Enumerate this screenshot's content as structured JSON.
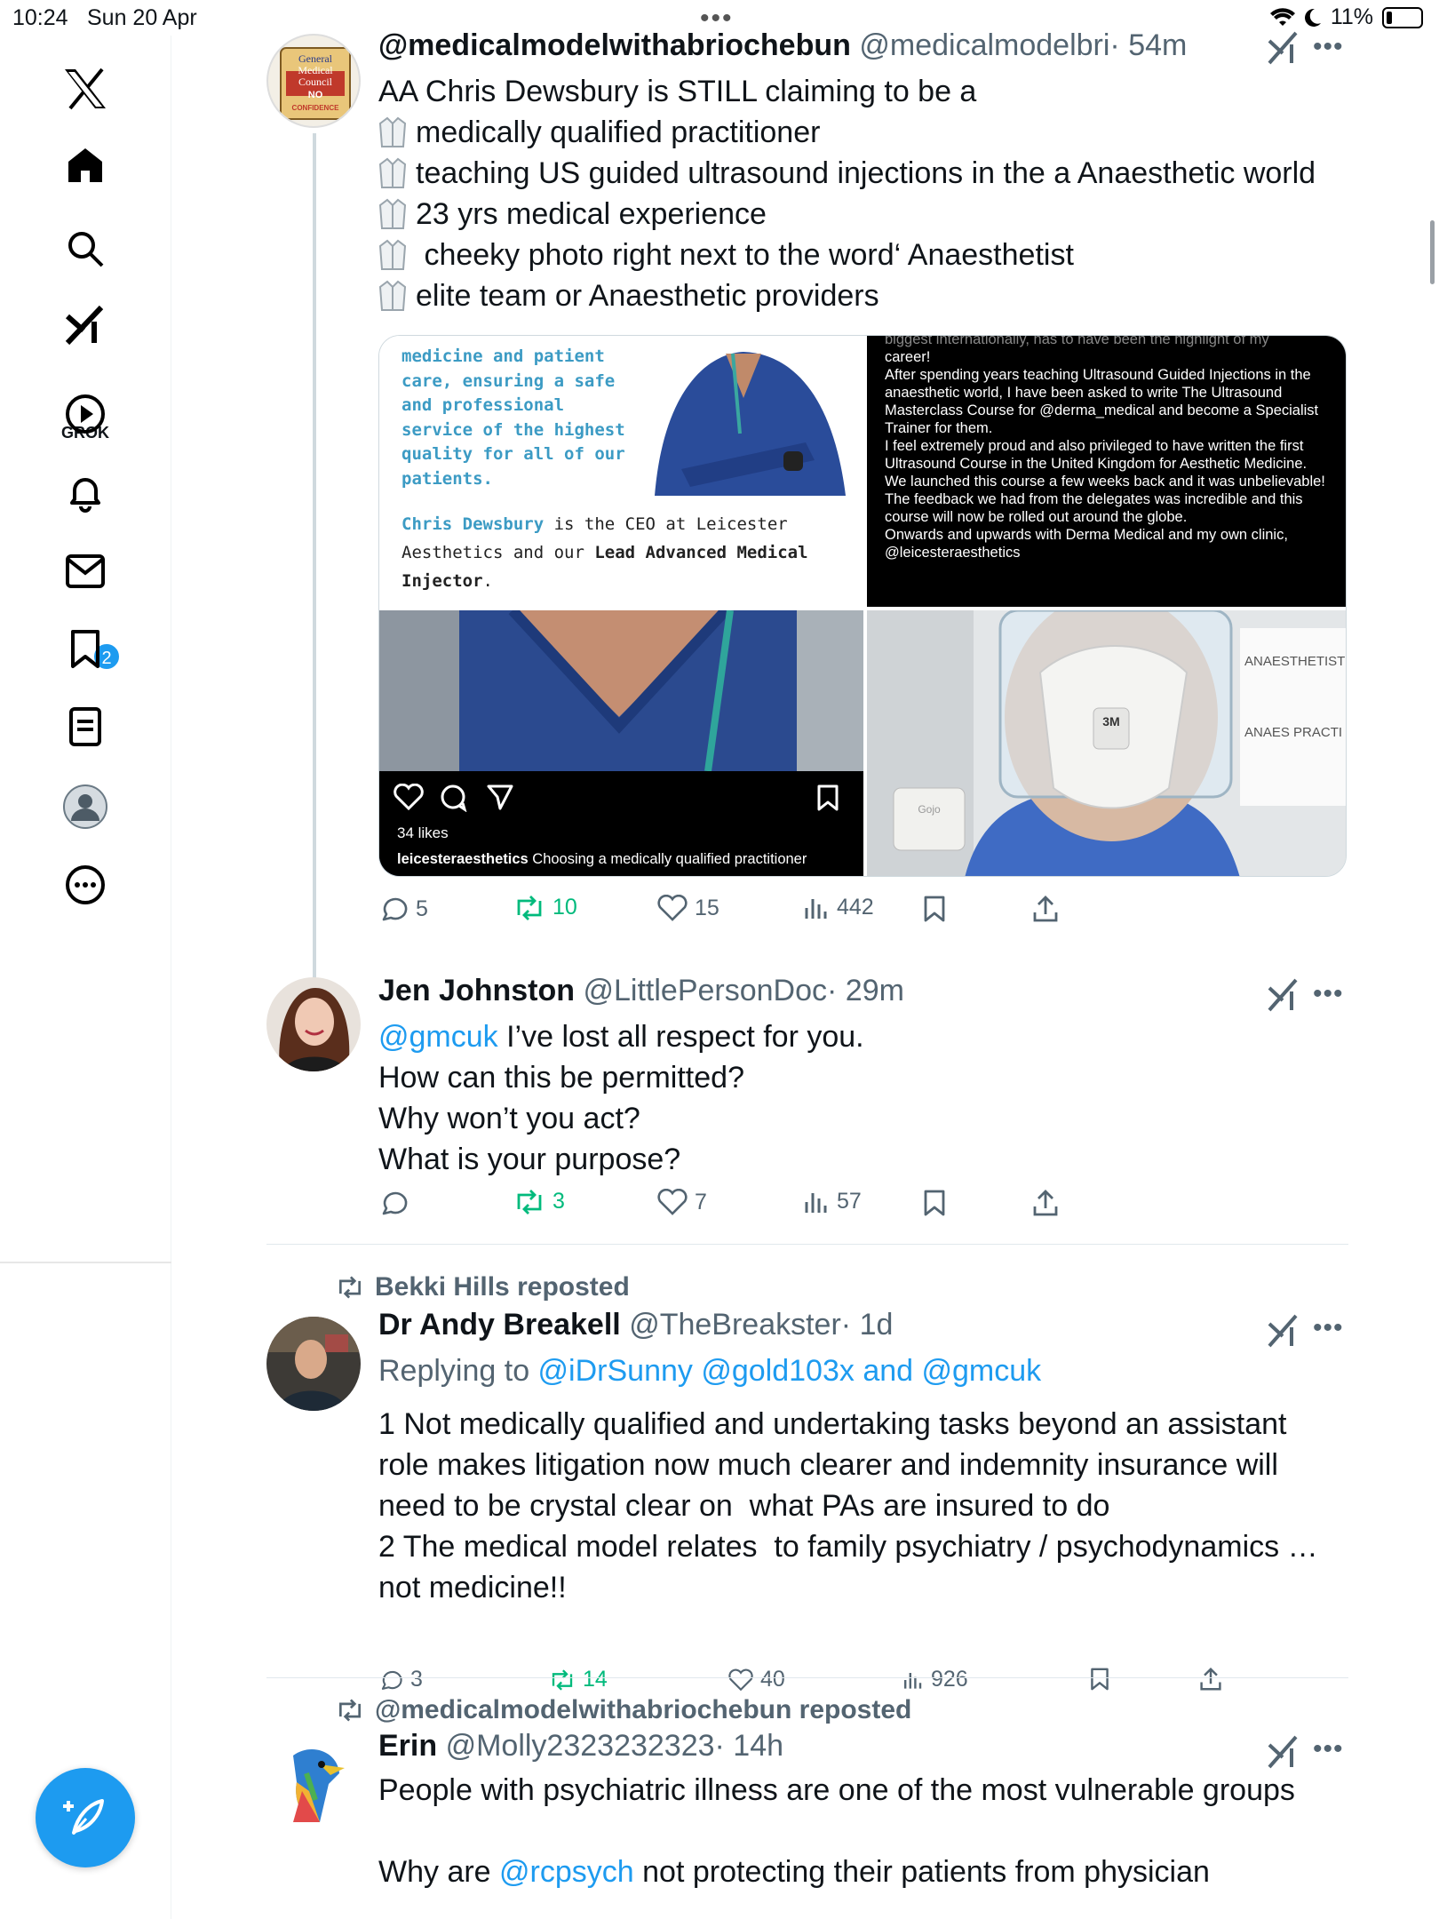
{
  "status_bar": {
    "time": "10:24",
    "date": "Sun 20 Apr",
    "battery": "11%"
  },
  "rail": {
    "grok_label": "GROK",
    "notifications_badge": "2"
  },
  "posts": [
    {
      "name": "@medicalmodelwithabriochebun",
      "handle": "@medicalmodelbri",
      "time": "· 54m",
      "avatar_text": [
        "General",
        "Medical",
        "Council",
        "NO",
        "CONFIDENCE"
      ],
      "lines": [
        "AA Chris Dewsbury is STILL claiming to be a",
        "medically qualified practitioner",
        "teaching US guided ultrasound injections in the a Anaesthetic world",
        "23 yrs medical experience",
        " cheeky photo right next to the word‘ Anaesthetist",
        "elite team or Anaesthetic providers"
      ],
      "media": {
        "m1_highlight": "medicine and patient care, ensuring a safe and professional service of the highest quality for all of our patients.",
        "m1_caption_name": "Chris Dewsbury",
        "m1_caption_mid": " is the CEO at Leicester Aesthetics and our ",
        "m1_caption_role": "Lead Advanced Medical Injector",
        "m1_caption_end": ".",
        "m2_text": [
          "biggest internationally, has to have been the highlight of my",
          "career!",
          "After spending years teaching Ultrasound Guided Injections in the anaesthetic world, I have been asked to write The Ultrasound Masterclass Course for @derma_medical and become a Specialist Trainer for them.",
          "I feel extremely proud and also privileged to have written the first Ultrasound Course in the United Kingdom for Aesthetic Medicine.",
          "We launched this course a few weeks back and it was unbelievable!",
          "The feedback we had from the delegates was incredible and this course will now be rolled out around the globe.",
          "Onwards and upwards with Derma Medical and my own clinic, @leicesteraesthetics"
        ],
        "m3_likes": "34 likes",
        "m3_caption_user": "leicesteraesthetics",
        "m3_caption": " Choosing a medically qualified practitioner",
        "m4_sign1": "ANAESTHETIST",
        "m4_sign2": "ANAES PRACTI",
        "m4_mask": "3M",
        "m4_dispenser": "Gojo"
      },
      "stats": {
        "replies": "5",
        "reposts": "10",
        "likes": "15",
        "views": "442"
      }
    },
    {
      "name": "Jen Johnston",
      "handle": "@LittlePersonDoc",
      "time": "· 29m",
      "mention": "@gmcuk",
      "lines": [
        " I’ve lost all respect for you.",
        "How can this be permitted?",
        "Why won’t you act?",
        "What is your purpose?"
      ],
      "stats": {
        "replies": "",
        "reposts": "3",
        "likes": "7",
        "views": "57"
      }
    },
    {
      "repost_by": "Bekki Hills reposted",
      "name": "Dr Andy Breakell",
      "handle": "@TheBreakster",
      "time": "· 1d",
      "replying_prefix": "Replying to ",
      "replying_to": "@iDrSunny @gold103x and @gmcuk",
      "lines": [
        "1 Not medically qualified and undertaking tasks beyond an assistant",
        "role makes litigation now much clearer and indemnity insurance will",
        "need to be crystal clear on  what PAs are insured to do",
        "2 The medical model relates  to family psychiatry / psychodynamics …",
        "not medicine!!"
      ],
      "stats": {
        "replies": "3",
        "reposts": "14",
        "likes": "40",
        "views": "926"
      }
    },
    {
      "repost_by": "@medicalmodelwithabriochebun reposted",
      "name": "Erin",
      "handle": "@Molly2323232323",
      "time": "· 14h",
      "line1": "People with psychiatric illness are one of the most vulnerable groups",
      "line2_prefix": "Why are ",
      "line2_mention": "@rcpsych",
      "line2_suffix": " not protecting their patients from physician"
    }
  ]
}
